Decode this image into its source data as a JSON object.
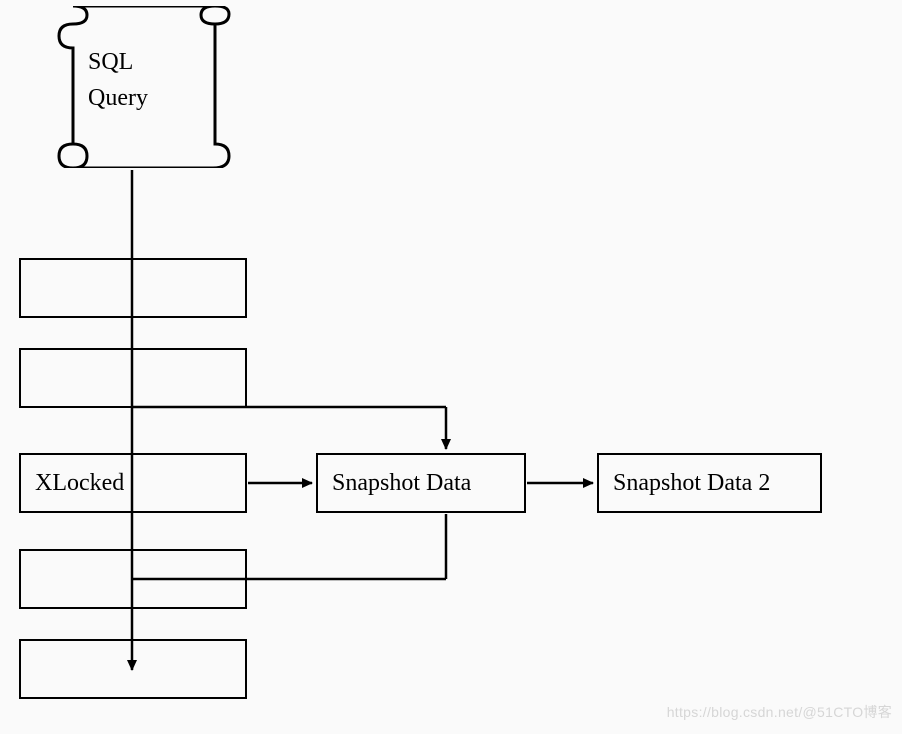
{
  "scroll": {
    "line1": "SQL",
    "line2": "Query"
  },
  "boxes": {
    "row1": "",
    "row2": "",
    "xlocked": "XLocked",
    "snapshot": "Snapshot Data",
    "snapshot2": "Snapshot Data 2",
    "row4": "",
    "row5": ""
  },
  "watermark": "https://blog.csdn.net/@51CTO博客"
}
